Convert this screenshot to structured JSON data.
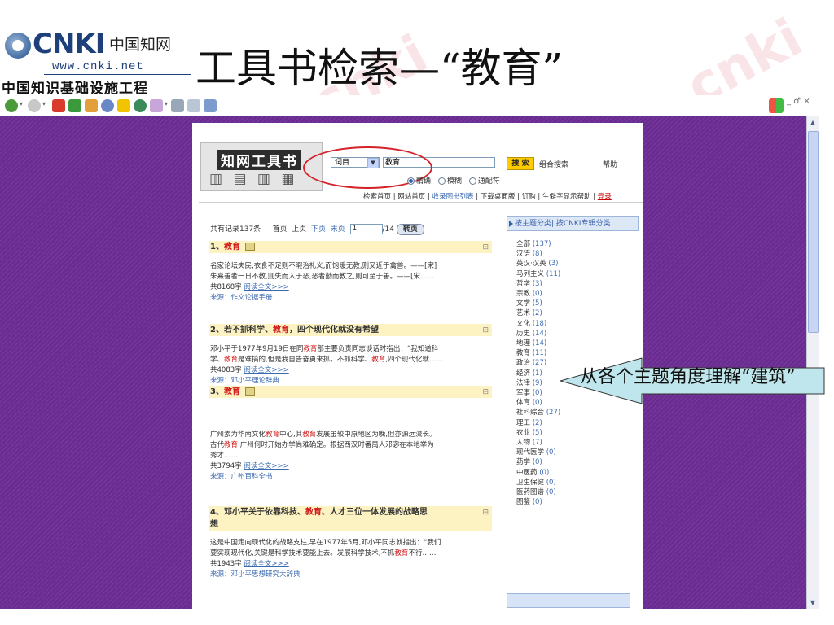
{
  "slide": {
    "title": "工具书检索—“教育”",
    "logo": {
      "brand": "CNKI",
      "cn_name": "中国知网",
      "url": "www.cnki.net",
      "project": "中国知识基础设施工程"
    },
    "callout_text": "从各个主题角度理解“建筑”"
  },
  "browser": {
    "window_controls": "_ ♂ ×"
  },
  "site": {
    "banner_title": "知网工具书",
    "search_field_select": "词目",
    "search_keyword": "教育",
    "match_modes": [
      "精确",
      "模糊",
      "通配符"
    ],
    "search_button": "搜 索",
    "combo_search": "组合搜索",
    "help": "帮助",
    "nav": {
      "home": "检索首页",
      "site_home": "网站首页",
      "catalog": "收录图书列表",
      "download": "下载桌面版",
      "order": "订购",
      "rare_char_help": "生僻字显示帮助",
      "login": "登录"
    }
  },
  "results": {
    "total": "共有记录137条",
    "first": "首页",
    "prev": "上页",
    "next": "下页",
    "last": "末页",
    "page_current": "1",
    "page_total": "/14",
    "goto": "转页",
    "items": [
      {
        "num": "1、",
        "title_kw": "教育",
        "title_rest": "",
        "lines": [
          "名家论坛夫民,衣食不足则不暇治礼义,而饱暖无教,则又近于禽兽。——[宋]",
          "朱熹善者一日不教,则失而入于恶,恶者勤而教之,则可至于善。——[宋……"
        ],
        "chars": "共8168字",
        "more": "阅读全文>>>",
        "source": "来源：作文论据手册"
      },
      {
        "num": "2、",
        "title_pre": "若不抓科学、",
        "title_kw": "教育",
        "title_rest": "，四个现代化就没有希望",
        "line1_pre": "邓小平于1977年9月19日在同",
        "line1_kw": "教育",
        "line1_post": "部主要负责同志谈话时指出：“我知道科",
        "line2_pre": "学、",
        "line2_kw": "教育",
        "line2_mid": "是难搞的,但是我自告奋勇来抓。不抓科学、",
        "line2_kw2": "教育",
        "line2_post": ",四个现代化就……",
        "chars": "共4083字",
        "more": "阅读全文>>>",
        "source": "来源：邓小平理论辞典"
      },
      {
        "num": "3、",
        "title_kw": "教育",
        "line1_pre": "广州素为华南文化",
        "line1_kw": "教育",
        "line1_mid": "中心,其",
        "line1_kw2": "教育",
        "line1_post": "发展虽较中原地区为晚,但亦源远流长。",
        "line2_pre": "古代",
        "line2_kw": "教育",
        "line2_post": " 广州何时开始办学尚难确定。根据西汉时番禺人邓宓在本地举为",
        "line3": "秀才……",
        "chars": "共3794字",
        "more": "阅读全文>>>",
        "source": "来源：广州百科全书"
      },
      {
        "num": "4、",
        "title_pre": "邓小平关于依靠科技、",
        "title_kw": "教育",
        "title_rest": "、人才三位一体发展的战略思",
        "title_line2": "想",
        "line1": "这是中国走向现代化的战略支柱,早在1977年5月,邓小平同志就指出：“我们",
        "line2_pre": "要实现现代化,关键是科学技术要能上去。发展科学技术,不抓",
        "line2_kw": "教育",
        "line2_post": "不行……",
        "chars": "共1943字",
        "more": "阅读全文>>>",
        "source": "来源：邓小平思想研究大辞典"
      }
    ]
  },
  "categories": {
    "header": "按主题分类| 按CNKI专辑分类",
    "items": [
      {
        "name": "全部",
        "count": "(137)"
      },
      {
        "name": "汉语",
        "count": "(8)"
      },
      {
        "name": "英汉·汉英",
        "count": "(3)"
      },
      {
        "name": "马列主义",
        "count": "(11)"
      },
      {
        "name": "哲学",
        "count": "(3)"
      },
      {
        "name": "宗教",
        "count": "(0)"
      },
      {
        "name": "文学",
        "count": "(5)"
      },
      {
        "name": "艺术",
        "count": "(2)"
      },
      {
        "name": "文化",
        "count": "(18)"
      },
      {
        "name": "历史",
        "count": "(14)"
      },
      {
        "name": "地理",
        "count": "(14)"
      },
      {
        "name": "教育",
        "count": "(11)"
      },
      {
        "name": "政治",
        "count": "(27)"
      },
      {
        "name": "经济",
        "count": "(1)"
      },
      {
        "name": "法律",
        "count": "(9)"
      },
      {
        "name": "军事",
        "count": "(0)"
      },
      {
        "name": "体育",
        "count": "(0)"
      },
      {
        "name": "社科综合",
        "count": "(27)"
      },
      {
        "name": "理工",
        "count": "(2)"
      },
      {
        "name": "农业",
        "count": "(5)"
      },
      {
        "name": "人物",
        "count": "(7)"
      },
      {
        "name": "现代医学",
        "count": "(0)"
      },
      {
        "name": "药学",
        "count": "(0)"
      },
      {
        "name": "中医药",
        "count": "(0)"
      },
      {
        "name": "卫生保健",
        "count": "(0)"
      },
      {
        "name": "医药图谱",
        "count": "(0)"
      },
      {
        "name": "图鉴",
        "count": "(0)"
      }
    ]
  },
  "colors": {
    "viewport": "#6b2c92",
    "keyword_red": "#d11a1a",
    "link_blue": "#3c6ab0",
    "title_bg": "#fcf2c2",
    "callout_fill": "#bfe6ec"
  }
}
